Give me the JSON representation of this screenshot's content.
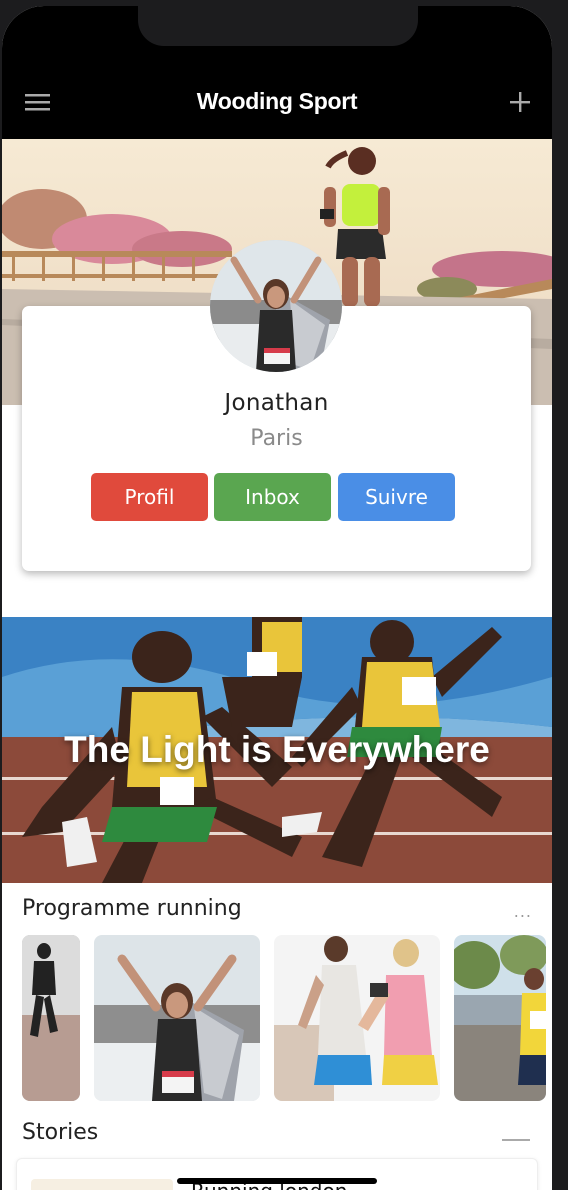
{
  "navbar": {
    "title": "Wooding Sport",
    "menu_icon": "hamburger-menu-icon",
    "add_icon": "plus-icon"
  },
  "profile": {
    "name": "Jonathan",
    "city": "Paris",
    "buttons": {
      "profil": "Profil",
      "inbox": "Inbox",
      "suivre": "Suivre"
    }
  },
  "banner": {
    "text": "The Light is Everywhere"
  },
  "programme": {
    "title": "Programme running",
    "more": "..."
  },
  "stories": {
    "title": "Stories",
    "first_story_title": "Running london"
  },
  "colors": {
    "profil_button": "#e04a3c",
    "inbox_button": "#5aa650",
    "suivre_button": "#4a8ee6",
    "navbar": "#000000"
  }
}
